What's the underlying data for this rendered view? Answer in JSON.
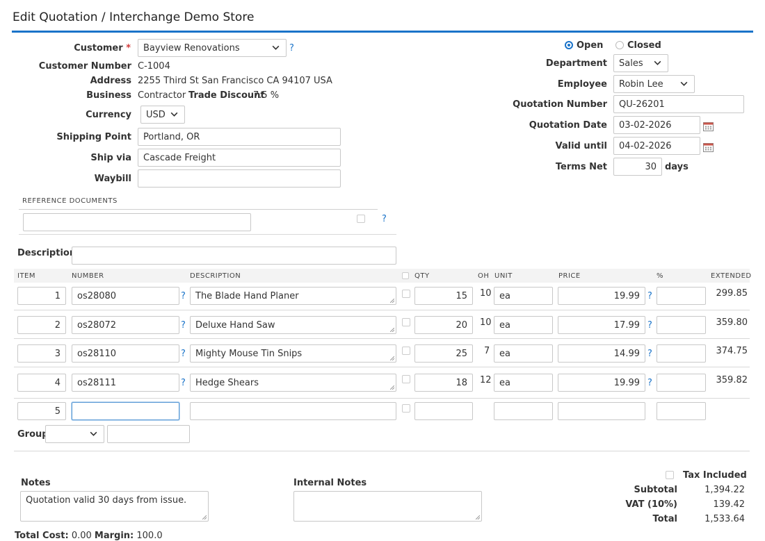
{
  "page": {
    "title": "Edit Quotation / Interchange Demo Store"
  },
  "header": {
    "customer_label": "Customer",
    "required_mark": "*",
    "customer_value": "Bayview Renovations",
    "help": "?",
    "customer_number_label": "Customer Number",
    "customer_number": "C-1004",
    "address_label": "Address",
    "address": "2255 Third St San Francisco CA 94107 USA",
    "business_label": "Business",
    "business": "Contractor",
    "trade_discount_label": "Trade Discount",
    "trade_discount": "7.5 %",
    "currency_label": "Currency",
    "currency": "USD",
    "shipping_point_label": "Shipping Point",
    "shipping_point": "Portland, OR",
    "ship_via_label": "Ship via",
    "ship_via": "Cascade Freight",
    "waybill_label": "Waybill",
    "waybill": ""
  },
  "status": {
    "open_label": "Open",
    "closed_label": "Closed",
    "selected": "Open",
    "department_label": "Department",
    "department": "Sales",
    "employee_label": "Employee",
    "employee": "Robin Lee",
    "quotation_number_label": "Quotation Number",
    "quotation_number": "QU-26201",
    "quotation_date_label": "Quotation Date",
    "quotation_date": "03-02-2026",
    "valid_until_label": "Valid until",
    "valid_until": "04-02-2026",
    "terms_label": "Terms Net",
    "terms": "30",
    "terms_unit": "days"
  },
  "reference": {
    "heading": "REFERENCE DOCUMENTS",
    "value": "",
    "help": "?"
  },
  "description": {
    "label": "Description",
    "value": ""
  },
  "lines": {
    "columns": [
      "ITEM",
      "NUMBER",
      "DESCRIPTION",
      "QTY",
      "OH",
      "UNIT",
      "PRICE",
      "%",
      "EXTENDED"
    ],
    "rows": [
      {
        "item": "1",
        "number": "os28080",
        "description": "The Blade Hand Planer",
        "qty": "15",
        "oh": "10",
        "unit": "ea",
        "price": "19.99",
        "discount": "",
        "extended": "299.85"
      },
      {
        "item": "2",
        "number": "os28072",
        "description": "Deluxe Hand Saw",
        "qty": "20",
        "oh": "10",
        "unit": "ea",
        "price": "17.99",
        "discount": "",
        "extended": "359.80"
      },
      {
        "item": "3",
        "number": "os28110",
        "description": "Mighty Mouse Tin Snips",
        "qty": "25",
        "oh": "7",
        "unit": "ea",
        "price": "14.99",
        "discount": "",
        "extended": "374.75"
      },
      {
        "item": "4",
        "number": "os28111",
        "description": "Hedge Shears",
        "qty": "18",
        "oh": "12",
        "unit": "ea",
        "price": "19.99",
        "discount": "",
        "extended": "359.82"
      }
    ],
    "new_row": {
      "item": "5",
      "number": "",
      "description": "",
      "qty": "",
      "unit": "",
      "price": "",
      "discount": ""
    },
    "help": "?"
  },
  "group": {
    "label": "Group",
    "select": "",
    "value": ""
  },
  "notes": {
    "notes_label": "Notes",
    "notes": "Quotation valid 30 days from issue.",
    "internal_label": "Internal Notes",
    "internal": ""
  },
  "totals": {
    "tax_included_label": "Tax Included",
    "subtotal_label": "Subtotal",
    "subtotal": "1,394.22",
    "vat_label": "VAT (10%)",
    "vat": "139.42",
    "total_label": "Total",
    "total": "1,533.64"
  },
  "footer": {
    "total_cost_label": "Total Cost:",
    "total_cost": "0.00",
    "margin_label": "Margin:",
    "margin": "100.0"
  },
  "colors": {
    "accent": "#1a73c9",
    "required": "#d23b3b"
  }
}
